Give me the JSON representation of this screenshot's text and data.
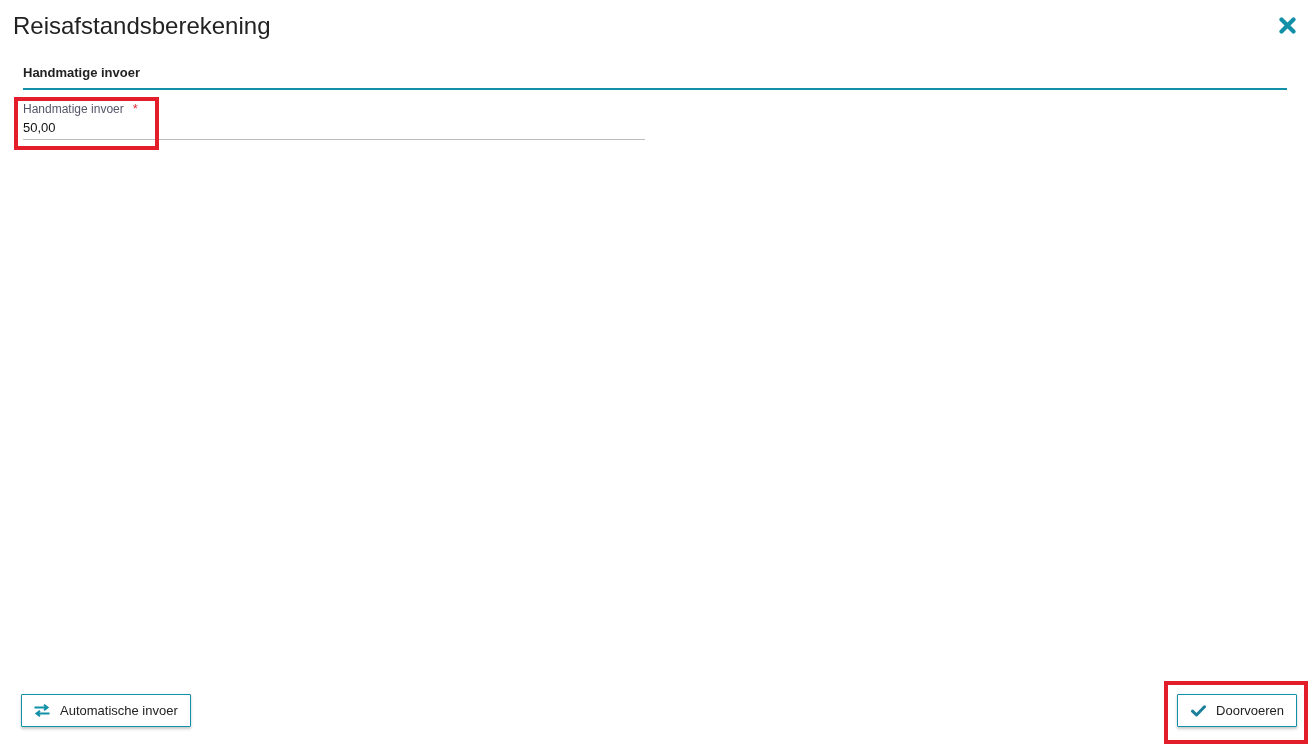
{
  "dialog": {
    "title": "Reisafstandsberekening"
  },
  "section": {
    "heading": "Handmatige invoer"
  },
  "field": {
    "label": "Handmatige invoer",
    "required_mark": "*",
    "value": "50,00",
    "highlighted": true
  },
  "buttons": [
    {
      "kind": "swap",
      "label": "Automatische invoer",
      "highlighted": false
    },
    {
      "kind": "apply",
      "label": "Doorvoeren",
      "highlighted": true
    }
  ]
}
